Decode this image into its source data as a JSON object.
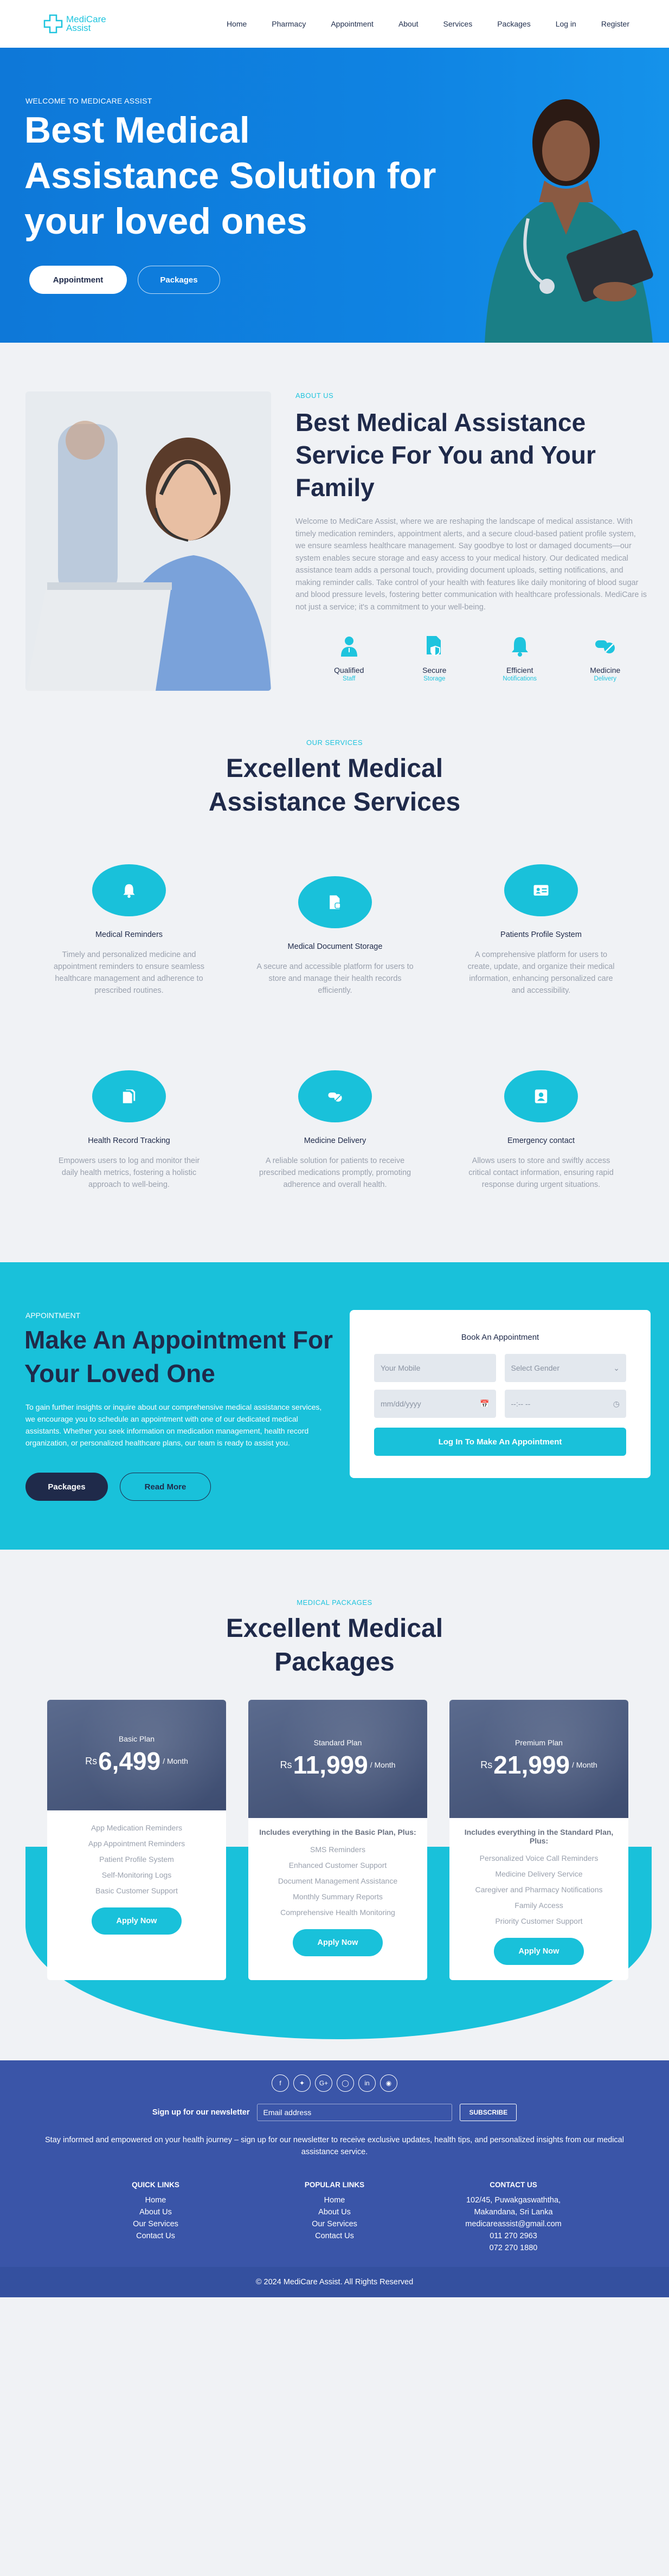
{
  "brand": {
    "name_line1": "MediCare",
    "name_line2": "Assist",
    "accent": "#1ec4de",
    "navy": "#1f2a4a",
    "hero_blue": "#0f83e2",
    "footer_blue": "#3a55a8"
  },
  "nav": {
    "items": [
      "Home",
      "Pharmacy",
      "Appointment",
      "About",
      "Services",
      "Packages",
      "Log in",
      "Register"
    ]
  },
  "hero": {
    "kicker": "WELCOME TO MEDICARE ASSIST",
    "title": "Best Medical Assistance Solution for your loved ones",
    "btn_primary": "Appointment",
    "btn_secondary": "Packages"
  },
  "about": {
    "kicker": "ABOUT US",
    "title": "Best Medical Assistance Service For You and Your Family",
    "paragraph": "Welcome to MediCare Assist, where we are reshaping the landscape of medical assistance. With timely medication reminders, appointment alerts, and a secure cloud-based patient profile system, we ensure seamless healthcare management. Say goodbye to lost or damaged documents—our system enables secure storage and easy access to your medical history. Our dedicated medical assistance team adds a personal touch, providing document uploads, setting notifications, and making reminder calls. Take control of your health with features like daily monitoring of blood sugar and blood pressure levels, fostering better communication with healthcare professionals. MediCare is not just a service; it's a commitment to your well-being.",
    "features": [
      {
        "icon": "doctor-icon",
        "title": "Qualified",
        "sub": "Staff"
      },
      {
        "icon": "secure-document-icon",
        "title": "Secure",
        "sub": "Storage"
      },
      {
        "icon": "bell-icon",
        "title": "Efficient",
        "sub": "Notifications"
      },
      {
        "icon": "pill-icon",
        "title": "Medicine",
        "sub": "Delivery"
      }
    ]
  },
  "services": {
    "kicker": "OUR SERVICES",
    "title": "Excellent Medical Assistance Services",
    "items": [
      {
        "icon": "bell-icon",
        "title": "Medical Reminders",
        "desc": "Timely and personalized medicine and appointment reminders to ensure seamless healthcare management and adherence to prescribed routines."
      },
      {
        "icon": "document-icon",
        "title": "Medical Document Storage",
        "desc": "A secure and accessible platform for users to store and manage their health records efficiently."
      },
      {
        "icon": "id-card-icon",
        "title": "Patients Profile System",
        "desc": "A comprehensive platform for users to create, update, and organize their medical information, enhancing personalized care and accessibility."
      },
      {
        "icon": "files-icon",
        "title": "Health Record Tracking",
        "desc": "Empowers users to log and monitor their daily health metrics, fostering a holistic approach to well-being."
      },
      {
        "icon": "pills-icon",
        "title": "Medicine Delivery",
        "desc": "A reliable solution for patients to receive prescribed medications promptly, promoting adherence and overall health."
      },
      {
        "icon": "contact-icon",
        "title": "Emergency contact",
        "desc": "Allows users to store and swiftly access critical contact information, ensuring rapid response during urgent situations."
      }
    ]
  },
  "appointment": {
    "kicker": "APPOINTMENT",
    "title": "Make An Appointment For Your Loved One",
    "paragraph": "To gain further insights or inquire about our comprehensive medical assistance services, we encourage you to schedule an appointment with one of our dedicated medical assistants. Whether you seek information on medication management, health record organization, or personalized healthcare plans, our team is ready to assist you.",
    "btn_primary": "Packages",
    "btn_secondary": "Read More",
    "form": {
      "title": "Book An Appointment",
      "mobile_placeholder": "Your Mobile",
      "gender_placeholder": "Select Gender",
      "date_placeholder": "mm/dd/yyyy",
      "time_placeholder": "--:-- --",
      "submit": "Log In To Make An Appointment"
    }
  },
  "packages": {
    "kicker": "MEDICAL PACKAGES",
    "title": "Excellent Medical Packages",
    "currency": "Rs",
    "per": "/ Month",
    "apply": "Apply Now",
    "plans": [
      {
        "name": "Basic Plan",
        "price": "6,499",
        "lead": "",
        "items": [
          "App Medication Reminders",
          "App Appointment Reminders",
          "Patient Profile System",
          "Self-Monitoring Logs",
          "Basic Customer Support"
        ]
      },
      {
        "name": "Standard Plan",
        "price": "11,999",
        "lead": "Includes everything in the Basic Plan, Plus:",
        "items": [
          "SMS Reminders",
          "Enhanced Customer Support",
          "Document Management Assistance",
          "Monthly Summary Reports",
          "Comprehensive Health Monitoring"
        ]
      },
      {
        "name": "Premium Plan",
        "price": "21,999",
        "lead": "Includes everything in the Standard Plan, Plus:",
        "items": [
          "Personalized Voice Call Reminders",
          "Medicine Delivery Service",
          "Caregiver and Pharmacy Notifications",
          "Family Access",
          "Priority Customer Support"
        ]
      }
    ]
  },
  "footer": {
    "socials": [
      "facebook-icon",
      "twitter-icon",
      "google-icon",
      "instagram-icon",
      "linkedin-icon",
      "github-icon"
    ],
    "newsletter_label": "Sign up for our newsletter",
    "email_placeholder": "Email address",
    "subscribe": "SUBSCRIBE",
    "newsletter_text": "Stay informed and empowered on your health journey – sign up for our newsletter to receive exclusive updates, health tips, and personalized insights from our medical assistance service.",
    "quick_links": {
      "title": "QUICK LINKS",
      "items": [
        "Home",
        "About Us",
        "Our Services",
        "Contact Us"
      ]
    },
    "popular_links": {
      "title": "POPULAR LINKS",
      "items": [
        "Home",
        "About Us",
        "Our Services",
        "Contact Us"
      ]
    },
    "contact": {
      "title": "CONTACT US",
      "items": [
        "102/45, Puwakgaswaththa,",
        "Makandana, Sri Lanka",
        "medicareassist@gmail.com",
        "011 270 2963",
        "072 270 1880"
      ]
    },
    "copyright": "© 2024 MediCare Assist. All Rights Reserved"
  }
}
